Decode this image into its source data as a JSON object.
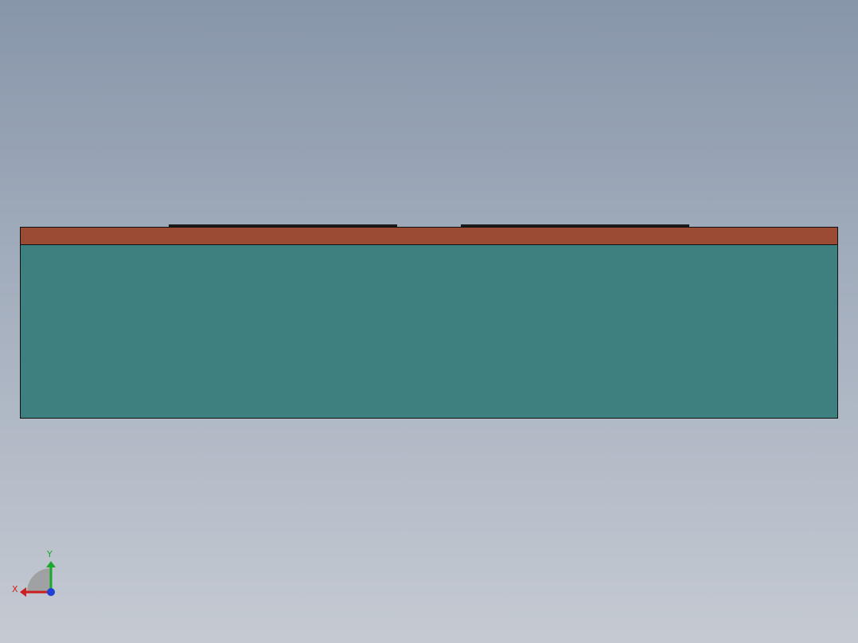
{
  "viewport": {
    "background_top": "#8896aa",
    "background_bottom": "#c5cad2"
  },
  "model": {
    "top_layer_color": "#9b4a33",
    "body_color": "#3e8080",
    "edge_color": "#111111",
    "strip_count": 2
  },
  "triad": {
    "x_label": "X",
    "y_label": "Y",
    "x_color": "#cc1f1f",
    "y_color": "#1aa82a",
    "z_color": "#1f3fd6"
  }
}
